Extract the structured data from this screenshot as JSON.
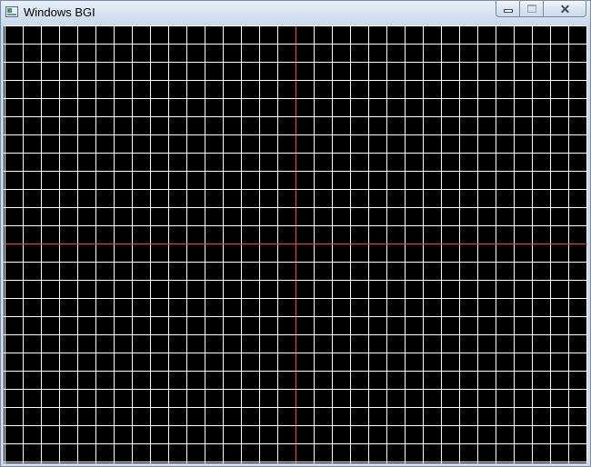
{
  "window": {
    "title": "Windows BGI",
    "icon": "bgi-window-icon",
    "controls": {
      "minimize_icon": "minimize-icon",
      "maximize_icon": "maximize-icon",
      "close_glyph": "✕"
    }
  },
  "canvas": {
    "background_color": "#000000",
    "grid_color": "#ffffff",
    "axis_color": "#ff3b3b",
    "grid_columns": 32,
    "grid_rows": 24,
    "axis_column_index": 16,
    "axis_row_index": 12
  }
}
